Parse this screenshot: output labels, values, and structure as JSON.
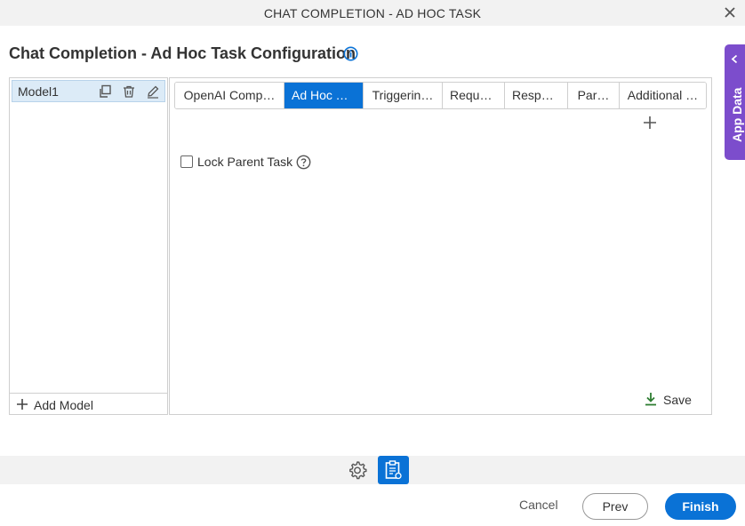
{
  "window": {
    "title": "CHAT COMPLETION - AD HOC TASK",
    "close_icon": "close-icon"
  },
  "heading": {
    "title": "Chat Completion - Ad Hoc Task Configuration",
    "info_icon": "info-icon"
  },
  "app_data": {
    "label": "App Data",
    "color": "#7c4dcc"
  },
  "models": {
    "items": [
      {
        "name": "Model1"
      }
    ],
    "add_label": "Add Model"
  },
  "tabs": [
    {
      "label": "OpenAI Comp…",
      "active": false
    },
    {
      "label": "Ad Hoc T…",
      "active": true
    },
    {
      "label": "Triggerin…",
      "active": false
    },
    {
      "label": "Reque…",
      "active": false
    },
    {
      "label": "Respo…",
      "active": false
    },
    {
      "label": "Par…",
      "active": false
    },
    {
      "label": "Additional …",
      "active": false
    }
  ],
  "form": {
    "lock_parent_task": {
      "label": "Lock Parent Task",
      "checked": false
    },
    "save_label": "Save"
  },
  "footer": {
    "cancel_label": "Cancel",
    "prev_label": "Prev",
    "finish_label": "Finish"
  },
  "colors": {
    "accent": "#0a72d6",
    "selected_row": "#dcebf7",
    "save_icon": "#2e7d32"
  }
}
